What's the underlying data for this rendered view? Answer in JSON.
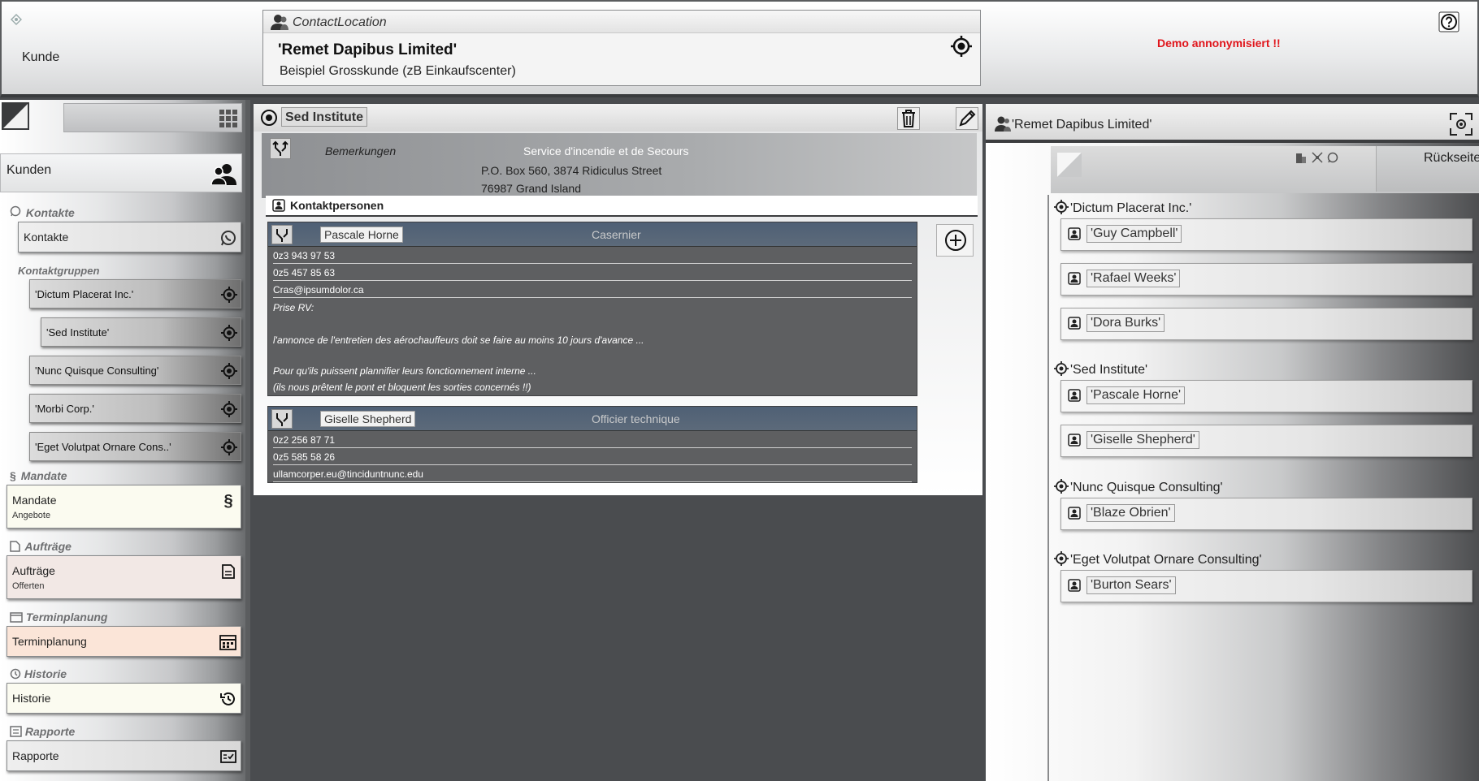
{
  "header": {
    "app_label": "Kunde",
    "contact_type": "ContactLocation",
    "contact_name": "'Remet Dapibus Limited'",
    "contact_sub": "Beispiel Grosskunde (zB Einkaufscenter)",
    "demo_notice": "Demo annonymisiert !!",
    "demo_color": "#e0151b"
  },
  "sidebar": {
    "kunden": "Kunden",
    "sections": {
      "kontakte": "Kontakte",
      "kontaktgruppen": "Kontaktgruppen",
      "mandate": "Mandate",
      "auftraege": "Aufträge",
      "terminplanung": "Terminplanung",
      "historie": "Historie",
      "rapporte": "Rapporte"
    },
    "items": {
      "kontakte": {
        "label": "Kontakte"
      },
      "mandate": {
        "label": "Mandate",
        "sub": "Angebote"
      },
      "auftraege": {
        "label": "Aufträge",
        "sub": "Offerten"
      },
      "terminplanung": {
        "label": "Terminplanung"
      },
      "historie": {
        "label": "Historie"
      },
      "rapporte": {
        "label": "Rapporte"
      }
    },
    "groups": [
      "'Dictum Placerat Inc.'",
      "'Sed Institute'",
      "'Nunc Quisque Consulting'",
      "'Morbi Corp.'",
      "'Eget Volutpat Ornare Cons..'"
    ]
  },
  "main": {
    "title": "Sed Institute",
    "bemerkungen_label": "Bemerkungen",
    "service": "Service d'incendie et de Secours",
    "address_line1": "P.O. Box 560, 3874 Ridiculus Street",
    "address_line2": "76987 Grand Island",
    "kontaktpersonen_label": "Kontaktpersonen",
    "persons": [
      {
        "name": "Pascale Horne",
        "role": "Casernier",
        "phone1": "0z3 943 97 53",
        "phone2": "0z5 457 85 63",
        "email": "Cras@ipsumdolor.ca",
        "note1": "Prise RV:",
        "note2": "l'annonce de l'entretien des aérochauffeurs doit se faire au moins 10 jours d'avance ...",
        "note3": "Pour qu'ils puissent plannifier leurs fonctionnement interne ...",
        "note4": "(ils nous prêtent le pont et bloquent les sorties concernés !!)"
      },
      {
        "name": "Giselle Shepherd",
        "role": "Officier technique",
        "phone1": "0z2 256 87 71",
        "phone2": "0z5 585 58 26",
        "email": "ullamcorper.eu@tinciduntnunc.edu"
      }
    ]
  },
  "right": {
    "title": "'Remet Dapibus Limited'",
    "back_label": "Rückseite",
    "groups": [
      {
        "name": "'Dictum Placerat Inc.'",
        "persons": [
          "'Guy Campbell'",
          "'Rafael Weeks'",
          "'Dora Burks'"
        ]
      },
      {
        "name": "'Sed Institute'",
        "persons": [
          "'Pascale Horne'",
          "'Giselle Shepherd'"
        ]
      },
      {
        "name": "'Nunc Quisque Consulting'",
        "persons": [
          "'Blaze Obrien'"
        ]
      },
      {
        "name": "'Eget Volutpat Ornare Consulting'",
        "persons": [
          "'Burton Sears'"
        ]
      }
    ]
  }
}
